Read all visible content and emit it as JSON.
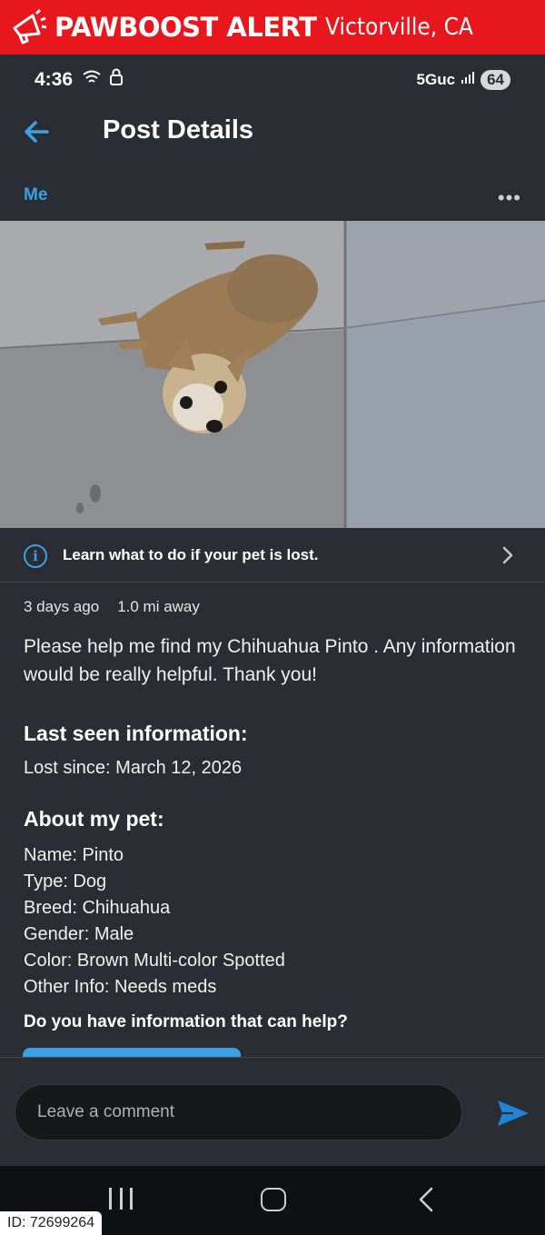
{
  "banner": {
    "title": "PAWBOOST ALERT",
    "city": "Victorville, CA",
    "icon": "megaphone-icon",
    "color": "#e8171d"
  },
  "status_bar": {
    "time": "4:36",
    "network": "5Guc",
    "battery": "64",
    "icons": [
      "wifi-icon",
      "lock-icon",
      "signal-icon"
    ]
  },
  "header": {
    "title": "Post Details",
    "back_icon": "arrow-left-icon"
  },
  "post": {
    "author": "Me",
    "more_icon": "more-horizontal-icon",
    "photo_alt": "Photo of brown chihuahua",
    "info_banner": "Learn what to do if your pet is lost.",
    "time_ago": "3 days ago",
    "distance": "1.0 mi away",
    "description": "Please help me find my Chihuahua  Pinto . Any information would be really helpful. Thank you!",
    "last_seen_title": "Last seen information:",
    "lost_since": "Lost since: March 12, 2026",
    "about_title": "About my pet:",
    "about": [
      "Name: Pinto",
      "Type: Dog",
      "Breed: Chihuahua",
      "Gender: Male",
      "Color:  Brown Multi-color Spotted",
      "Other Info: Needs meds"
    ],
    "help_question": "Do you have information that can help?"
  },
  "comment": {
    "placeholder": "Leave a comment",
    "send_icon": "send-icon"
  },
  "nav": {
    "icons": [
      "recent-apps-icon",
      "home-icon",
      "back-icon"
    ]
  },
  "watermark": "ID: 72699264",
  "colors": {
    "accent": "#3aa1e6",
    "background": "#2a2d33"
  }
}
